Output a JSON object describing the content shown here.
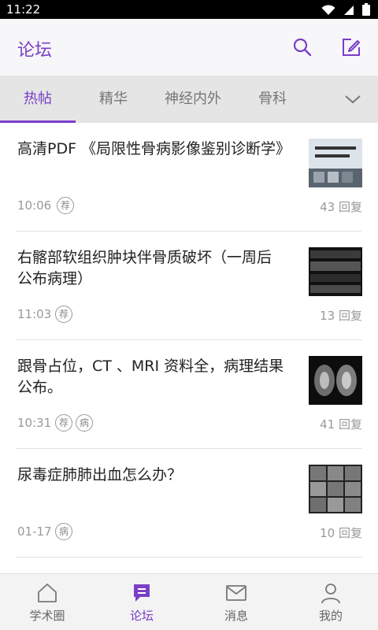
{
  "status_bar": {
    "time": "11:22"
  },
  "app_bar": {
    "title": "论坛"
  },
  "tabs": [
    {
      "label": "热帖"
    },
    {
      "label": "精华"
    },
    {
      "label": "神经内外"
    },
    {
      "label": "骨科"
    }
  ],
  "posts": [
    {
      "title": "高清PDF 《局限性骨病影像鉴别诊断学》",
      "time": "10:06",
      "badges": [
        "荐"
      ],
      "replies": "43 回复",
      "thumb_text": "局限性骨病\n影像鉴别诊断学"
    },
    {
      "title": "右髂部软组织肿块伴骨质破坏（一周后公布病理）",
      "time": "11:03",
      "badges": [
        "荐"
      ],
      "replies": "13 回复"
    },
    {
      "title": "跟骨占位，CT 、MRI 资料全，病理结果公布。",
      "time": "10:31",
      "badges": [
        "荐",
        "病"
      ],
      "replies": "41 回复"
    },
    {
      "title": "尿毒症肺肺出血怎么办？",
      "time": "01-17",
      "badges": [
        "病"
      ],
      "replies": "10 回复"
    }
  ],
  "bottom_nav": [
    {
      "label": "学术圈"
    },
    {
      "label": "论坛"
    },
    {
      "label": "消息"
    },
    {
      "label": "我的"
    }
  ],
  "colors": {
    "accent": "#7a3fc7",
    "tab_bg": "#e5e5e5",
    "app_bar_bg": "#f7f6f9"
  }
}
